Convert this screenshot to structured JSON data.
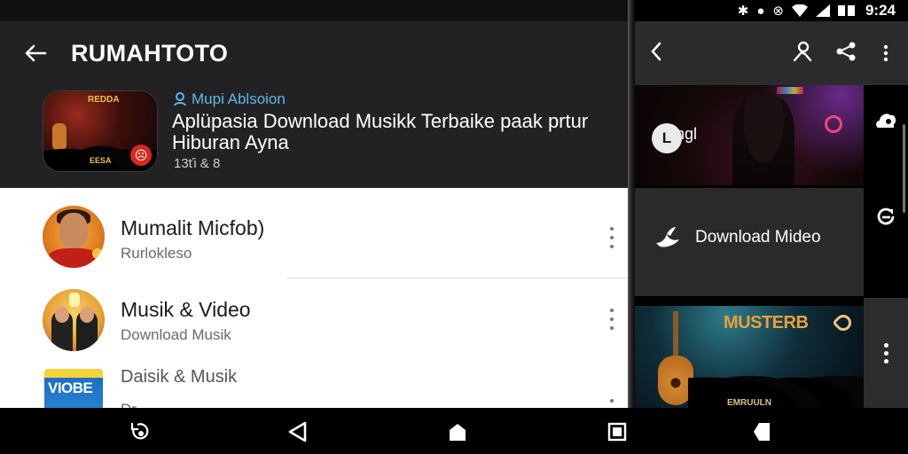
{
  "status_bar": {
    "time": "9:24",
    "icons": [
      "nfc-icon",
      "record-icon",
      "alarm-icon",
      "wifi-icon",
      "signal-icon",
      "battery-icon"
    ]
  },
  "left_app": {
    "title": "RUMAHTOTO",
    "featured": {
      "author": "Mupi Ablsoion",
      "title": "Aplüpasia Download Musikk Terbaike paak prtur Hiburan Ayna",
      "count": "13ťi & 8",
      "thumb_text_top": "REDDA",
      "thumb_text_bottom": "EESA"
    },
    "list": [
      {
        "title": "Mumalit Micfob)",
        "subtitle": "Rurlokleso"
      },
      {
        "title": "Musik & Video",
        "subtitle": "Download Musik"
      },
      {
        "title": "Daisik & Musik",
        "subtitle": "Dr",
        "thumb_text": "VIOBE"
      }
    ]
  },
  "right_app": {
    "items": [
      {
        "badge": "L",
        "label": "ngl"
      },
      {
        "label": "Download Mideo"
      },
      {
        "title": "MUSTERB",
        "subtitle": "EMRUULN"
      }
    ]
  },
  "colors": {
    "accent": "#5fb7e8",
    "pink": "#f2437a",
    "appbar": "#222224",
    "badge_red": "#d9291c"
  }
}
